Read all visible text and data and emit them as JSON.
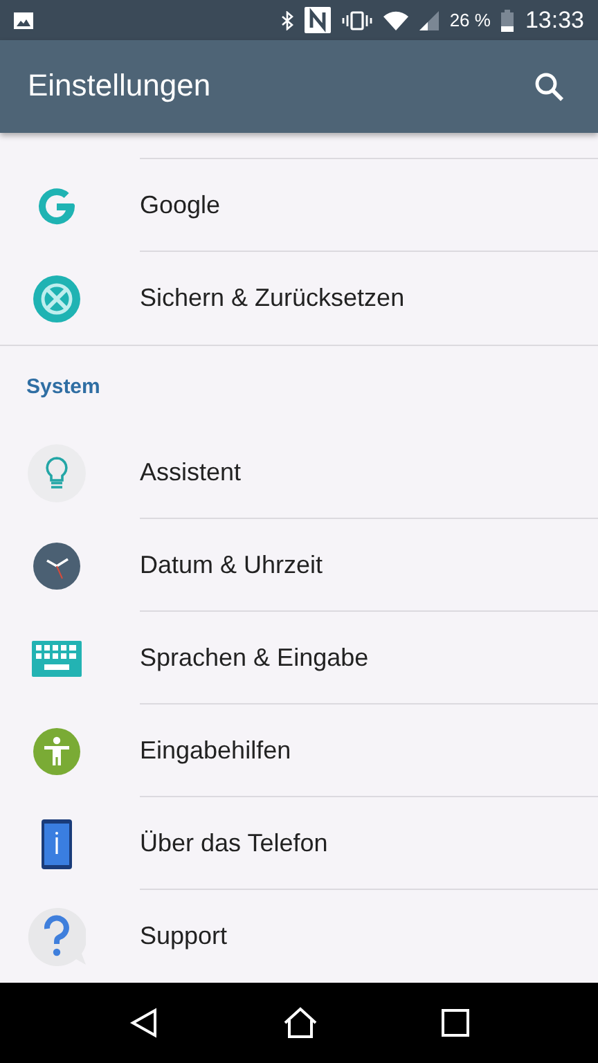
{
  "status_bar": {
    "battery": "26 %",
    "time": "13:33"
  },
  "app_bar": {
    "title": "Einstellungen"
  },
  "sections": [
    {
      "items": [
        {
          "label": "Google"
        },
        {
          "label": "Sichern & Zurücksetzen"
        }
      ]
    },
    {
      "header": "System",
      "items": [
        {
          "label": "Assistent"
        },
        {
          "label": "Datum & Uhrzeit"
        },
        {
          "label": "Sprachen & Eingabe"
        },
        {
          "label": "Eingabehilfen"
        },
        {
          "label": "Über das Telefon"
        },
        {
          "label": "Support"
        }
      ]
    }
  ]
}
